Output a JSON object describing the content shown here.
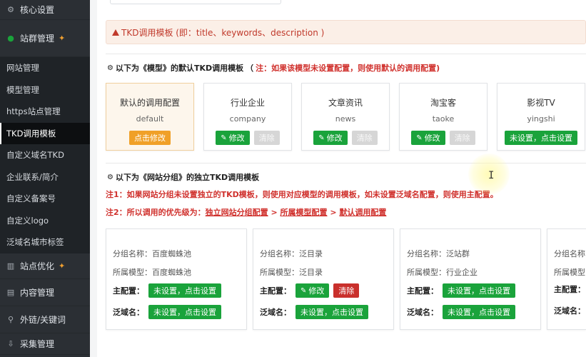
{
  "sidebar": {
    "core_settings": "核心设置",
    "site_group": "站群管理",
    "site_group_items": [
      {
        "label": "网站管理"
      },
      {
        "label": "模型管理"
      },
      {
        "label": "https站点管理"
      },
      {
        "label": "TKD调用模板",
        "active": true
      },
      {
        "label": "自定义域名TKD"
      },
      {
        "label": "企业联系/简介"
      },
      {
        "label": "自定义备案号"
      },
      {
        "label": "自定义logo"
      },
      {
        "label": "泛域名城市标签"
      }
    ],
    "site_optimize": "站点优化",
    "content_mgmt": "内容管理",
    "links_keywords": "外链/关键词",
    "collect_mgmt": "采集管理"
  },
  "alert": {
    "text": "TKD调用模板 (即：title、keywords、description )"
  },
  "model_section": {
    "title": "以下为《模型》的默认TKD调用模板",
    "paren": "（",
    "note": "注：如果该模型未设置配置，则使用默认的调用配置)",
    "cards": [
      {
        "name": "默认的调用配置",
        "code": "default",
        "btn": "点击修改"
      },
      {
        "name": "行业企业",
        "code": "company",
        "edit": "修改",
        "clear": "清除"
      },
      {
        "name": "文章资讯",
        "code": "news",
        "edit": "修改",
        "clear": "清除"
      },
      {
        "name": "淘宝客",
        "code": "taoke",
        "edit": "修改",
        "clear": "清除"
      },
      {
        "name": "影视TV",
        "code": "yingshi",
        "btn": "未设置，点击设置"
      }
    ]
  },
  "group_section": {
    "title": "以下为《网站分组》的独立TKD调用模板",
    "note1": "注1：如果网站分组未设置独立的TKD模板，则使用对应模型的调用模板，如未设置泛域名配置，则使用主配置。",
    "note2_prefix": "注2：所以调用的优先级为：",
    "note2_link1": "独立网站分组配置",
    "note2_sep1": " > ",
    "note2_link2": "所属模型配置",
    "note2_sep2": " > ",
    "note2_link3": "默认调用配置",
    "labels": {
      "group_name": "分组名称：",
      "model": "所属模型：",
      "main_config": "主配置：",
      "wildcard": "泛域名："
    },
    "cards": [
      {
        "group": "百度蜘蛛池",
        "model": "百度蜘蛛池",
        "main_btn": "未设置，点击设置",
        "wild_btn": "未设置，点击设置"
      },
      {
        "group": "泛目录",
        "model": "泛目录",
        "edit": "修改",
        "clear": "清除",
        "wild_btn": "未设置，点击设置"
      },
      {
        "group": "泛站群",
        "model": "行业企业",
        "main_btn": "未设置，点击设置",
        "wild_btn": "未设置，点击设置"
      },
      {
        "group": "",
        "model": ""
      }
    ]
  },
  "cursor_glyph": "I",
  "colors": {
    "green": "#1aa33b",
    "orange": "#f0a028",
    "red": "#c9302c",
    "note_red": "#d0312d",
    "sidebar_bg": "#2b2f34"
  }
}
